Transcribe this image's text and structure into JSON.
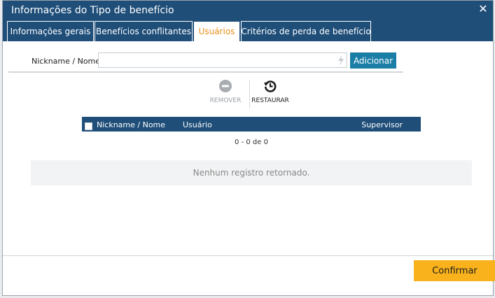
{
  "dialog": {
    "title": "Informações do Tipo de benefício",
    "close_glyph": "✕"
  },
  "tabs": [
    {
      "label": "Informações gerais"
    },
    {
      "label": "Benefícios conflitantes"
    },
    {
      "label": "Usuários",
      "active": true
    },
    {
      "label": "Critérios de perda de benefício"
    }
  ],
  "form": {
    "nickname_label": "Nickname / Nome:",
    "nickname_value": "",
    "nickname_placeholder": "",
    "add_label": "Adicionar"
  },
  "actions": {
    "remove_label": "REMOVER",
    "restore_label": "RESTAURAR"
  },
  "grid": {
    "columns": [
      "Nickname / Nome",
      "Usuário",
      "Supervisor"
    ],
    "pager": "0 - 0 de 0",
    "empty_message": "Nenhum registro retornado."
  },
  "footer": {
    "confirm_label": "Confirmar"
  },
  "colors": {
    "header_blue": "#1f4e79",
    "active_tab_text": "#e8901a",
    "add_button": "#1a7ea6",
    "confirm_button": "#f9b21c"
  },
  "icons": {
    "close": "close-icon",
    "bolt": "lightning-icon",
    "remove": "minus-circle-icon",
    "restore": "restore-history-icon"
  }
}
